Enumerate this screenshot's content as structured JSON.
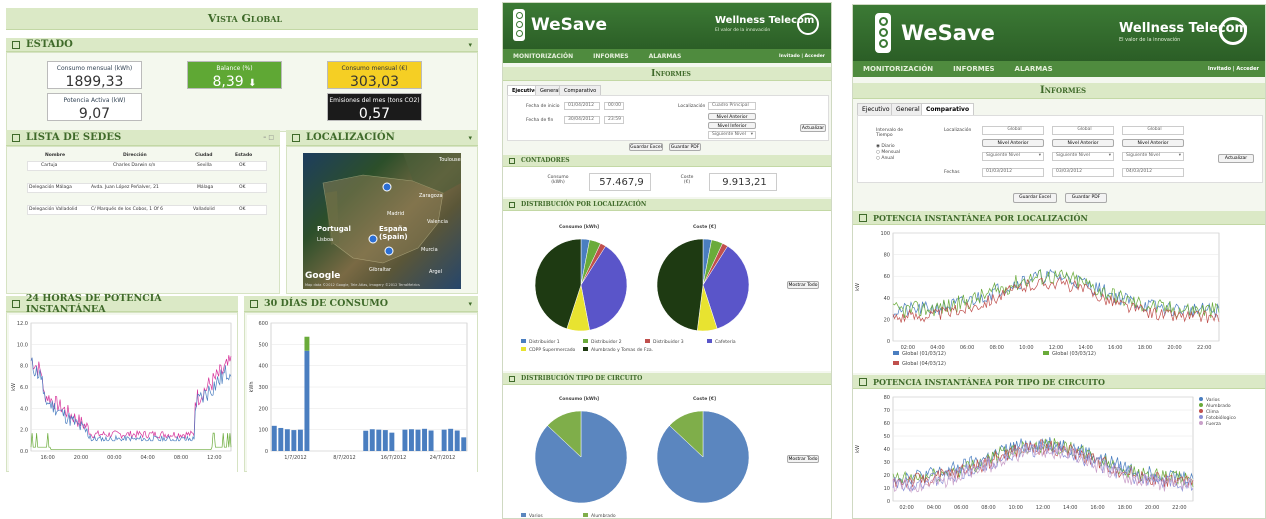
{
  "left": {
    "title": "Vista Global",
    "estado": {
      "title": "ESTADO",
      "kpis": [
        {
          "label": "Consumo mensual (kWh)",
          "value": "1899,33"
        },
        {
          "label": "Potencia Activa (kW)",
          "value": "9,07"
        },
        {
          "label": "Balance (%)",
          "value": "8,39"
        },
        {
          "label": "Consumo mensual (€)",
          "value": "303,03"
        },
        {
          "label": "Emisiones del mes (tons CO2)",
          "value": "0,57"
        }
      ]
    },
    "sedes": {
      "title": "LISTA DE SEDES",
      "columns": [
        "Nombre",
        "Dirección",
        "Ciudad",
        "Estado"
      ],
      "rows": [
        [
          "Cartuja",
          "Charles Darwin s/n",
          "Sevilla",
          "OK"
        ],
        [
          "Delegación Málaga",
          "Avda. Juan López Peñalver, 21",
          "Málaga",
          "OK"
        ],
        [
          "Delegación Valladolid",
          "C/ Marqués de los Cobos, 1 Of 6",
          "Valladolid",
          "OK"
        ]
      ]
    },
    "localizacion": {
      "title": "LOCALIZACIÓN",
      "labels": [
        "Portugal",
        "Lisboa",
        "España (Spain)",
        "Madrid",
        "Zaragoza",
        "Murcia",
        "Gibraltar",
        "Valencia",
        "Toulouse",
        "Argel"
      ],
      "google": "Google",
      "credits": "Map data ©2012 Google, Tele Atlas, Imagery ©2012 TerraMetrics"
    },
    "potencia24": {
      "title": "24 HORAS DE POTENCIA INSTANTÁNEA",
      "ylabel": "kW",
      "yticks": [
        "12.0",
        "10.0",
        "8.0",
        "6.0",
        "4.0",
        "2.0",
        "0.0"
      ],
      "xticks": [
        "16:00",
        "20:00",
        "00:00",
        "04:00",
        "08:00",
        "12:00"
      ]
    },
    "consumo30": {
      "title": "30 DÍAS DE CONSUMO",
      "ylabel": "kWh",
      "yticks": [
        "600",
        "500",
        "400",
        "300",
        "200",
        "100",
        "0"
      ],
      "xticks": [
        "1/7/2012",
        "8/7/2012",
        "16/7/2012",
        "24/7/2012"
      ]
    }
  },
  "mid": {
    "brand": "WeSave",
    "company": "Wellness Telecom",
    "slogan": "El valor de la innovación",
    "nav": [
      "MONITORIZACIÓN",
      "INFORMES",
      "ALARMAS"
    ],
    "user": "Invitado | Acceder",
    "page_title": "Informes",
    "tabs": [
      "Ejecutivo",
      "General",
      "Comparativo"
    ],
    "form": {
      "fecha_inicio_label": "Fecha de inicio",
      "fecha_inicio": "01/04/2012",
      "hora_inicio": "00:00",
      "fecha_fin_label": "Fecha de fin",
      "fecha_fin": "30/04/2012",
      "hora_fin": "23:59",
      "localizacion_label": "Localización",
      "localizacion": "Cuadro Principal",
      "nivel_anterior": "Nivel Anterior",
      "nivel_inferior": "Nivel Inferior",
      "siguiente_nivel": "Siguiente Nivel",
      "actualizar": "Actualizar",
      "guardar_excel": "Guardar Excel",
      "guardar_pdf": "Guardar PDF"
    },
    "contadores": {
      "title": "CONTADORES",
      "consumo_label": "Consumo (kWh)",
      "consumo": "57.467,9",
      "coste_label": "Coste (€)",
      "coste": "9.913,21"
    },
    "dist_loc": {
      "title": "DISTRIBUCIÓN POR LOCALIZACIÓN",
      "pie1_title": "Consumo [kWh]",
      "pie2_title": "Coste [€]",
      "show_all": "Mostrar Todo",
      "legend": [
        "Distribuidor 1",
        "Distribuidor 2",
        "Distribuidor 3",
        "Cafetería",
        "CDPP Supermercado",
        "Alumbrado y Tomas de Fza."
      ]
    },
    "dist_circ": {
      "title": "DISTRIBUCIÓN TIPO DE CIRCUITO",
      "pie1_title": "Consumo [kWh]",
      "pie2_title": "Coste [€]",
      "show_all": "Mostrar Todo",
      "legend": [
        "Varios",
        "Alumbrado"
      ]
    }
  },
  "right": {
    "brand": "WeSave",
    "company": "Wellness Telecom",
    "slogan": "El valor de la innovación",
    "nav": [
      "MONITORIZACIÓN",
      "INFORMES",
      "ALARMAS"
    ],
    "user": "Invitado | Acceder",
    "page_title": "Informes",
    "tabs": [
      "Ejecutivo",
      "General",
      "Comparativo"
    ],
    "form": {
      "intervalo_label": "Intervalo de Tiempo",
      "radios": [
        "Diario",
        "Mensual",
        "Anual"
      ],
      "localizacion_label": "Localización",
      "global": "Global",
      "nivel_anterior": "Nivel Anterior",
      "siguiente_nivel": "Siguiente Nivel",
      "fechas_label": "Fechas",
      "fechas": [
        "01/03/2012",
        "03/03/2012",
        "04/03/2012"
      ],
      "actualizar": "Actualizar",
      "guardar_excel": "Guardar Excel",
      "guardar_pdf": "Guardar PDF"
    },
    "chart1": {
      "title": "POTENCIA INSTANTÁNEA POR LOCALIZACIÓN",
      "ylabel": "kW",
      "yticks": [
        "100",
        "80",
        "60",
        "40",
        "20",
        "0"
      ],
      "xticks": [
        "02:00",
        "04:00",
        "06:00",
        "08:00",
        "10:00",
        "12:00",
        "14:00",
        "16:00",
        "18:00",
        "20:00",
        "22:00"
      ],
      "legend": [
        "Global (01/03/12)",
        "Global (03/03/12)",
        "Global (04/03/12)"
      ]
    },
    "chart2": {
      "title": "POTENCIA INSTANTÁNEA POR TIPO DE CIRCUITO",
      "ylabel": "kW",
      "yticks": [
        "80",
        "70",
        "60",
        "50",
        "40",
        "30",
        "20",
        "10",
        "0"
      ],
      "xticks": [
        "02:00",
        "04:00",
        "06:00",
        "08:00",
        "10:00",
        "12:00",
        "14:00",
        "16:00",
        "18:00",
        "20:00",
        "22:00"
      ],
      "legend": [
        "Varios",
        "Alumbrado",
        "Clima",
        "Fotobiólogico",
        "Fuerza"
      ]
    }
  },
  "colors": {
    "header_bg": "#dbe9c6",
    "header_text": "#3f6a2a",
    "brand_green": "#3c7a35",
    "series_blue": "#4a7ec0",
    "series_pink": "#d6339a",
    "series_green": "#6aab3a",
    "series_red": "#c0504d",
    "pie_dark": "#1e3a12",
    "pie_yellow": "#e8e330",
    "pie_purple": "#5a55c9"
  }
}
